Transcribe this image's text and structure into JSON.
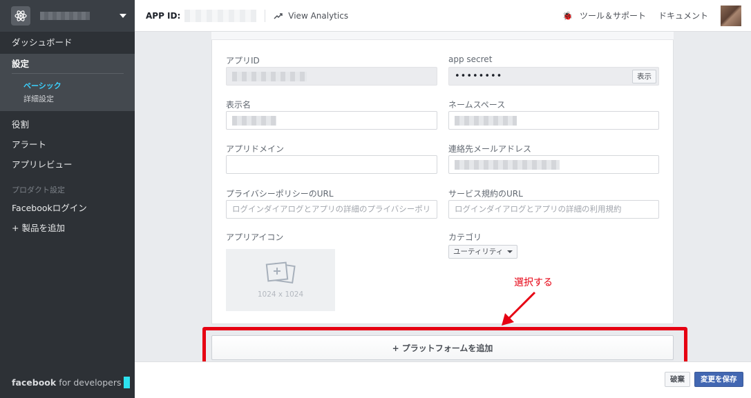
{
  "sidebar": {
    "items": [
      {
        "label": "ダッシュボード"
      },
      {
        "label": "設定"
      },
      {
        "label": "役割"
      },
      {
        "label": "アラート"
      },
      {
        "label": "アプリレビュー"
      }
    ],
    "settings_sub": [
      {
        "label": "ベーシック"
      },
      {
        "label": "詳細設定"
      }
    ],
    "product_section": "プロダクト設定",
    "product_items": [
      {
        "label": "Facebookログイン"
      },
      {
        "label": "+ 製品を追加"
      }
    ],
    "footer_brand": "facebook",
    "footer_suffix": "for developers"
  },
  "topbar": {
    "app_id_label": "APP ID:",
    "analytics": "View Analytics",
    "tools": "ツール＆サポート",
    "docs": "ドキュメント"
  },
  "form": {
    "app_id": {
      "label": "アプリID"
    },
    "app_secret": {
      "label": "app secret",
      "value": "••••••••",
      "show_button": "表示"
    },
    "display_name": {
      "label": "表示名"
    },
    "namespace": {
      "label": "ネームスペース"
    },
    "app_domain": {
      "label": "アプリドメイン",
      "value": ""
    },
    "contact_email": {
      "label": "連絡先メールアドレス"
    },
    "privacy_url": {
      "label": "プライバシーポリシーのURL",
      "placeholder": "ログインダイアログとアプリの詳細のプライバシーポリ"
    },
    "terms_url": {
      "label": "サービス規約のURL",
      "placeholder": "ログインダイアログとアプリの詳細の利用規約"
    },
    "app_icon": {
      "label": "アプリアイコン",
      "size": "1024 x 1024"
    },
    "category": {
      "label": "カテゴリ",
      "value": "ユーティリティ"
    }
  },
  "add_platform": "+ プラットフォームを追加",
  "annotation": "選択する",
  "actions": {
    "discard": "破棄",
    "save": "変更を保存"
  },
  "colors": {
    "sidebar_bg": "#2d3136",
    "active_sub": "#3bd2ff",
    "annotation_red": "#e60012",
    "save_blue": "#4267b2"
  }
}
